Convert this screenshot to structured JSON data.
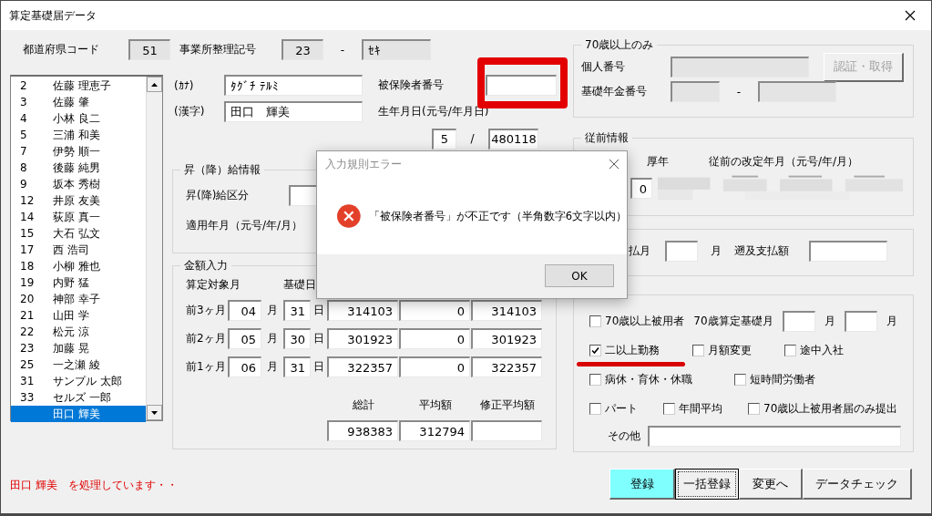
{
  "window": {
    "title": "算定基礎届データ"
  },
  "prefecture_code": {
    "label": "都道府県コード",
    "value": "51"
  },
  "office_code": {
    "label": "事業所整理記号",
    "value": "23",
    "separator": "-",
    "suffix": "ｾｷ"
  },
  "employee_list": {
    "items": [
      {
        "number": "2",
        "name": "佐藤 理恵子",
        "selected": false
      },
      {
        "number": "3",
        "name": "佐藤 肇",
        "selected": false
      },
      {
        "number": "4",
        "name": "小林 良二",
        "selected": false
      },
      {
        "number": "5",
        "name": "三浦 和美",
        "selected": false
      },
      {
        "number": "7",
        "name": "伊勢 順一",
        "selected": false
      },
      {
        "number": "8",
        "name": "後藤 純男",
        "selected": false
      },
      {
        "number": "9",
        "name": "坂本 秀樹",
        "selected": false
      },
      {
        "number": "12",
        "name": "井原 友美",
        "selected": false
      },
      {
        "number": "14",
        "name": "荻原 真一",
        "selected": false
      },
      {
        "number": "15",
        "name": "大石 弘文",
        "selected": false
      },
      {
        "number": "17",
        "name": "西 浩司",
        "selected": false
      },
      {
        "number": "18",
        "name": "小柳 雅也",
        "selected": false
      },
      {
        "number": "19",
        "name": "内野 猛",
        "selected": false
      },
      {
        "number": "20",
        "name": "神部 幸子",
        "selected": false
      },
      {
        "number": "21",
        "name": "山田 学",
        "selected": false
      },
      {
        "number": "22",
        "name": "松元 涼",
        "selected": false
      },
      {
        "number": "23",
        "name": "加藤 晃",
        "selected": false
      },
      {
        "number": "25",
        "name": "一之瀬 綾",
        "selected": false
      },
      {
        "number": "31",
        "name": "サンプル 太郎",
        "selected": false
      },
      {
        "number": "33",
        "name": "セルズ 一郎",
        "selected": false
      },
      {
        "name": "田口 輝美",
        "selected": true
      }
    ]
  },
  "kana": {
    "label": "(ｶﾅ)",
    "value": "ﾀｸﾞﾁ ﾃﾙﾐ"
  },
  "kanji": {
    "label": "(漢字)",
    "value": "田口　輝美"
  },
  "insured_number": {
    "label": "被保険者番号",
    "highlighted": true
  },
  "birth_date": {
    "label": "生年月日(元号/年月日)",
    "era": "5",
    "separator": "/",
    "date": "480118"
  },
  "raise_info": {
    "title": "昇（降）給情報",
    "category_label": "昇(降)給区分",
    "applied_label": "適用年月（元号/年/月）"
  },
  "amounts": {
    "title": "金額入力",
    "headers": [
      "算定対象月",
      "基礎日"
    ],
    "rows": [
      {
        "label": "前3ヶ月",
        "month": "04",
        "month_unit": "月",
        "days": "31",
        "day_unit": "日",
        "values": [
          "314103",
          "0",
          "314103"
        ]
      },
      {
        "label": "前2ヶ月",
        "month": "05",
        "month_unit": "月",
        "days": "30",
        "day_unit": "日",
        "values": [
          "301923",
          "0",
          "301923"
        ]
      },
      {
        "label": "前1ヶ月",
        "month": "06",
        "month_unit": "月",
        "days": "31",
        "day_unit": "日",
        "values": [
          "322357",
          "0",
          "322357"
        ]
      }
    ],
    "total_headers": [
      "総計",
      "平均額",
      "修正平均額"
    ],
    "totals": [
      "938383",
      "312794"
    ]
  },
  "status": "田口 輝美　を処理しています・・",
  "over70": {
    "title": "70歳以上のみ",
    "personal_number_label": "個人番号",
    "auth_button": {
      "label": "認証・取得",
      "disabled": true
    },
    "pension_label": "基礎年金番号",
    "separator": "-"
  },
  "previous": {
    "title": "従前情報",
    "headers": [
      "厚年",
      "従前の改定年月（元号/年/月）"
    ],
    "value": "0"
  },
  "payment": {
    "month_label": "払月",
    "month_unit": "月",
    "retro_label": "遡及支払額"
  },
  "flags": {
    "rows": [
      [
        {
          "kind": "checkbox",
          "label": "70歳以上被用者",
          "checked": false,
          "underlined": false
        },
        {
          "kind": "label",
          "label": "70歳算定基礎月"
        },
        {
          "kind": "field"
        },
        {
          "kind": "label",
          "label": "月"
        },
        {
          "kind": "field"
        },
        {
          "kind": "label",
          "label": "月"
        }
      ],
      [
        {
          "kind": "checkbox",
          "label": "二以上勤務",
          "checked": true,
          "underlined": true
        },
        {
          "kind": "checkbox",
          "label": "月額変更",
          "checked": false,
          "underlined": false
        },
        {
          "kind": "checkbox",
          "label": "途中入社",
          "checked": false,
          "underlined": false
        }
      ],
      [
        {
          "kind": "checkbox",
          "label": "病休・育休・休職",
          "checked": false,
          "underlined": false
        },
        {
          "kind": "checkbox",
          "label": "短時間労働者",
          "checked": false,
          "underlined": false
        }
      ],
      [
        {
          "kind": "checkbox",
          "label": "パート",
          "checked": false,
          "underlined": false
        },
        {
          "kind": "checkbox",
          "label": "年間平均",
          "checked": false,
          "underlined": false
        },
        {
          "kind": "checkbox",
          "label": "70歳以上被用者届のみ提出",
          "checked": false,
          "underlined": false
        }
      ]
    ],
    "other_label": "その他"
  },
  "buttons": [
    {
      "label": "登録",
      "kind": "primary"
    },
    {
      "label": "一括登録",
      "kind": "focused"
    },
    {
      "label": "変更へ",
      "kind": "normal"
    },
    {
      "label": "データチェック",
      "kind": "normal"
    }
  ],
  "dialog": {
    "title": "入力規則エラー",
    "message": "「被保険者番号」が不正です（半角数字6文字以内）",
    "button": "OK"
  }
}
